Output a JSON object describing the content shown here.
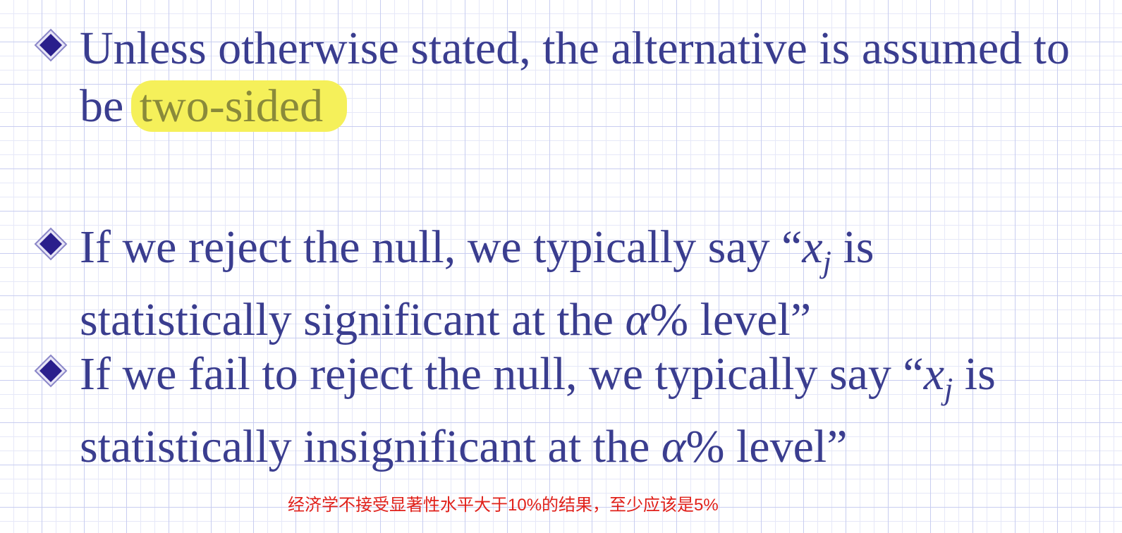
{
  "bullets": [
    {
      "text_before": "Unless otherwise stated, the alternative is assumed to be",
      "highlight": "two-sided"
    },
    {
      "text_1": "If we reject the null, we typically say “",
      "var": "x",
      "sub": "j",
      "text_2": " is statistically significant at the ",
      "alpha": "α",
      "text_3": "% level”"
    },
    {
      "text_1": "If we fail to reject the null, we typically say “",
      "var": "x",
      "sub": "j",
      "text_2": " is statistically insignificant at the ",
      "alpha": "α",
      "text_3": "% level”"
    }
  ],
  "note": "经济学不接受显著性水平大于10%的结果，至少应该是5%",
  "colors": {
    "text": "#3a3d8f",
    "bullet": "#2a1f8c",
    "highlight": "#f5f05a",
    "note": "#e0201a"
  },
  "icons": {
    "bullet": "diamond-bullet-icon"
  }
}
